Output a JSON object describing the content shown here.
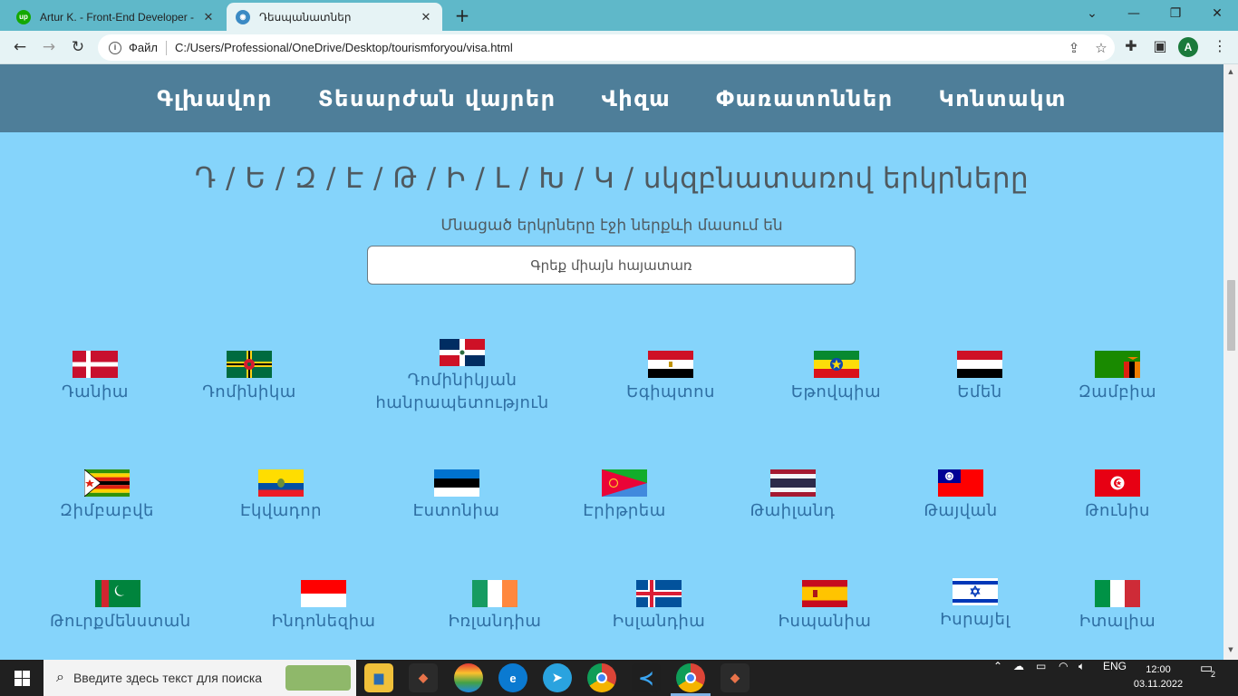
{
  "browser": {
    "tabs": [
      {
        "title": "Artur K. - Front-End Developer - ",
        "active": false
      },
      {
        "title": "Դեսպանատներ",
        "active": true
      }
    ],
    "address_prefix": "Файл",
    "url": "C:/Users/Professional/OneDrive/Desktop/tourismforyou/visa.html",
    "profile_initial": "A"
  },
  "nav": {
    "items": [
      "Գլխավոր",
      "Տեսարժան վայրեր",
      "Վիզա",
      "Փառատոններ",
      "Կոնտակտ"
    ]
  },
  "heading": "Դ / Ե / Զ / Է / Թ / Ի / Լ / Խ / Կ / սկզբնատառով երկրները",
  "subheading": "Մնացած երկրները էջի ներքևի մասում են",
  "search": {
    "placeholder": "Գրեք միայն հայատառ",
    "value": ""
  },
  "countries": [
    {
      "name": "Դանիա"
    },
    {
      "name": "Դոմինիկա"
    },
    {
      "name": "Դոմինիկյան հանրապետություն"
    },
    {
      "name": "Եգիպտոս"
    },
    {
      "name": "Եթովպիա"
    },
    {
      "name": "Եմեն"
    },
    {
      "name": "Զամբիա"
    },
    {
      "name": "Զիմբաբվե"
    },
    {
      "name": "Էկվադոր"
    },
    {
      "name": "Էստոնիա"
    },
    {
      "name": "Էրիթրեա"
    },
    {
      "name": "Թաիլանդ"
    },
    {
      "name": "Թայվան"
    },
    {
      "name": "Թունիս"
    },
    {
      "name": "Թուրքմենստան"
    },
    {
      "name": "Ինդոնեզիա"
    },
    {
      "name": "Իռլանդիա"
    },
    {
      "name": "Իսլանդիա"
    },
    {
      "name": "Իսպանիա"
    },
    {
      "name": "Իսրայել"
    },
    {
      "name": "Իտալիա"
    }
  ],
  "taskbar": {
    "search_placeholder": "Введите здесь текст для поиска",
    "language": "ENG",
    "time": "12:00",
    "date": "03.11.2022",
    "notifications": "2"
  }
}
